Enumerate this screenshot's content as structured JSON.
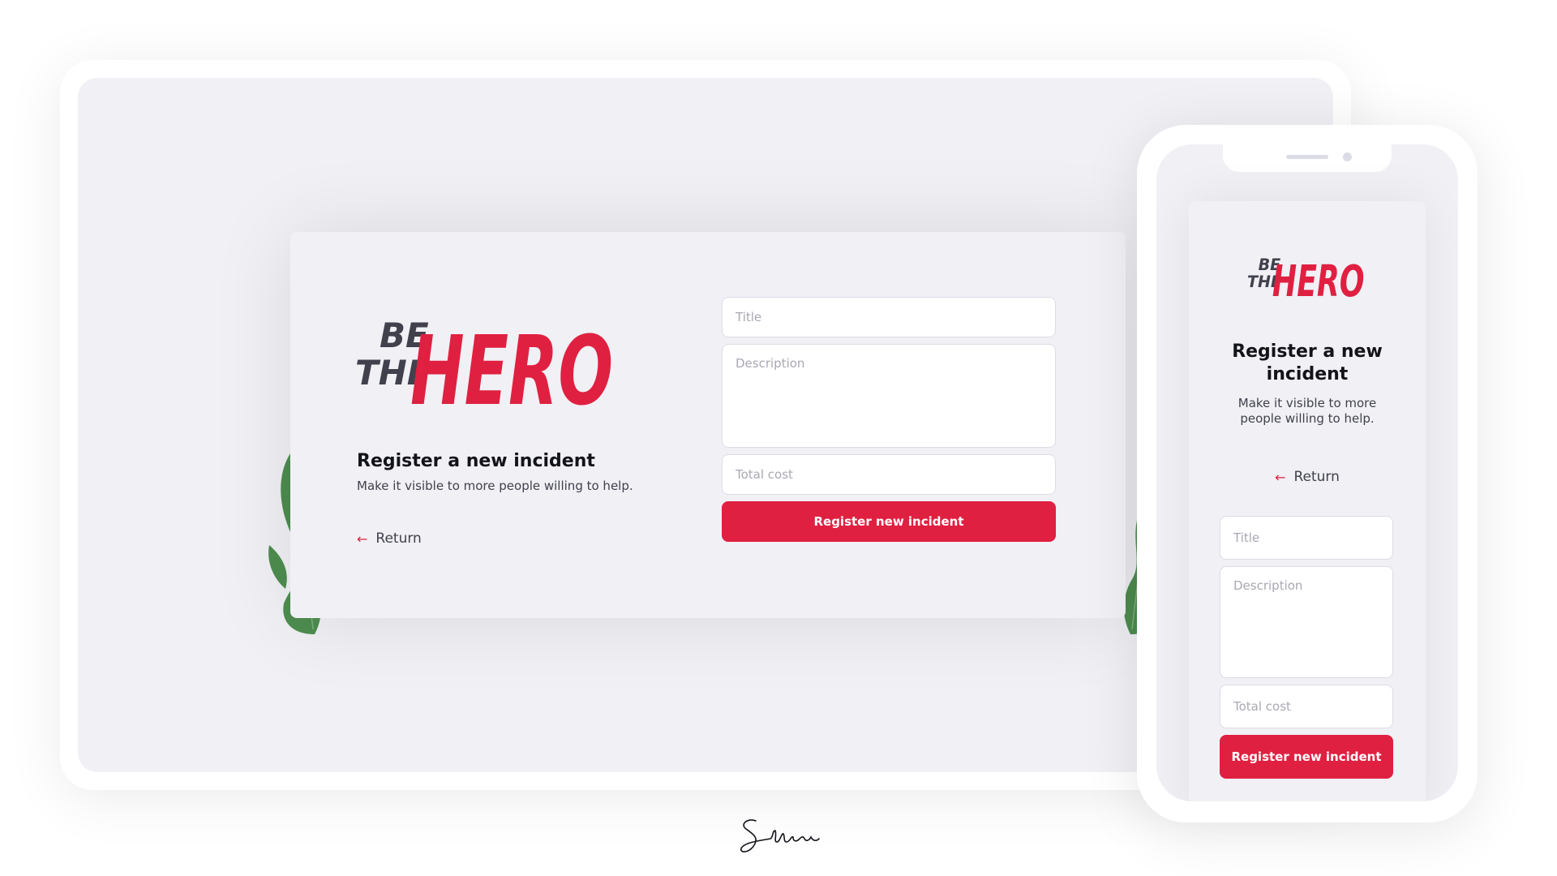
{
  "brand": {
    "logo_top": "BE",
    "logo_bottom": "THE",
    "logo_main": "HERO",
    "accent_color": "#e02041",
    "dark_color": "#41414d",
    "background_color": "#f0f0f5",
    "plant_color": "#4e8d4f"
  },
  "desktop": {
    "title": "Register a new incident",
    "subtitle": "Make it visible to more people willing to help.",
    "back_label": "Return",
    "back_icon": "arrow-left-icon",
    "form": {
      "title_placeholder": "Title",
      "description_placeholder": "Description",
      "cost_placeholder": "Total cost",
      "submit_label": "Register new incident"
    }
  },
  "mobile": {
    "title": "Register a new incident",
    "subtitle": "Make it visible to more people willing to help.",
    "back_label": "Return",
    "back_icon": "arrow-left-icon",
    "form": {
      "title_placeholder": "Title",
      "description_placeholder": "Description",
      "cost_placeholder": "Total cost",
      "submit_label": "Register new incident"
    }
  },
  "signature": {
    "icon": "signature-icon"
  }
}
